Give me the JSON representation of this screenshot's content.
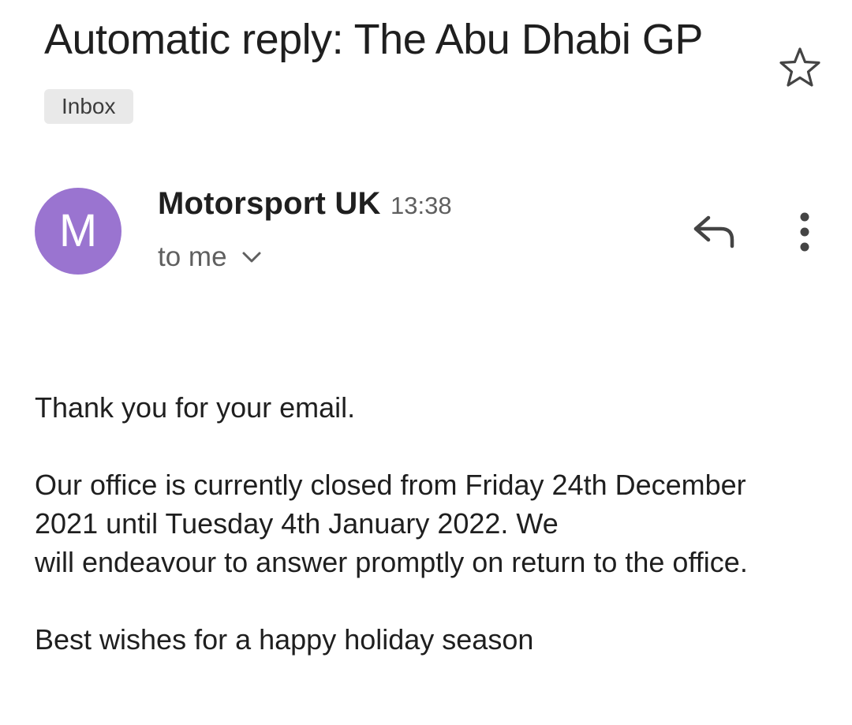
{
  "email": {
    "subject": "Automatic reply: The Abu Dhabi GP",
    "label": "Inbox",
    "sender": {
      "initial": "M",
      "name": "Motorsport UK",
      "time": "13:38",
      "recipient": "to me",
      "avatar_color": "#9a74d0"
    },
    "body": {
      "line1": "Thank you for your email.",
      "line2": "Our office is currently closed from Friday 24th December",
      "line3": "2021 until Tuesday 4th January 2022. We",
      "line4": "will endeavour to answer promptly on return to the office.",
      "line5": "Best wishes for a happy holiday season"
    }
  },
  "icons": {
    "star": "star-outline-icon",
    "reply": "reply-arrow-icon",
    "more": "more-vertical-icon",
    "expand": "chevron-down-icon"
  }
}
